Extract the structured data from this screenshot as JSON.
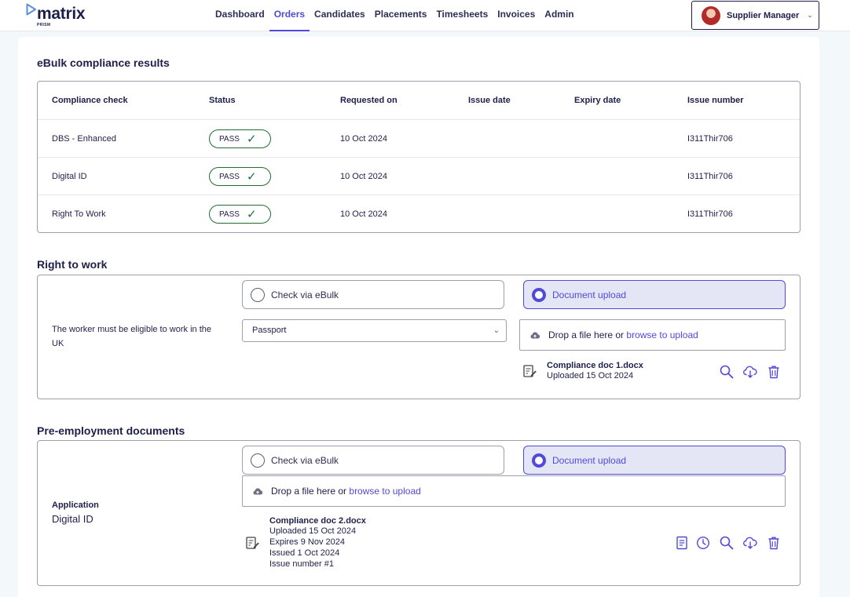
{
  "header": {
    "logo_word": "matrix",
    "logo_sub": "PRISM",
    "nav": [
      {
        "label": "Dashboard",
        "active": false
      },
      {
        "label": "Orders",
        "active": true
      },
      {
        "label": "Candidates",
        "active": false
      },
      {
        "label": "Placements",
        "active": false
      },
      {
        "label": "Timesheets",
        "active": false
      },
      {
        "label": "Invoices",
        "active": false
      },
      {
        "label": "Admin",
        "active": false
      }
    ],
    "user": "Supplier Manager"
  },
  "ebulk": {
    "title": "eBulk compliance results",
    "columns": [
      "Compliance check",
      "Status",
      "Requested on",
      "Issue date",
      "Expiry date",
      "Issue number"
    ],
    "rows": [
      {
        "check": "DBS - Enhanced",
        "status": "PASS",
        "requested": "10 Oct 2024",
        "issue_date": "",
        "expiry_date": "",
        "issue_number": "I311Thir706"
      },
      {
        "check": "Digital ID",
        "status": "PASS",
        "requested": "10 Oct 2024",
        "issue_date": "",
        "expiry_date": "",
        "issue_number": "I311Thir706"
      },
      {
        "check": "Right To Work",
        "status": "PASS",
        "requested": "10 Oct 2024",
        "issue_date": "",
        "expiry_date": "",
        "issue_number": "I311Thir706"
      }
    ]
  },
  "rtw": {
    "title": "Right to work",
    "requirement": "The worker must be eligible to work in the UK",
    "option_ebulk": "Check via eBulk",
    "option_upload": "Document upload",
    "selected": "upload",
    "doc_type": "Passport",
    "drop_text": "Drop a file here or",
    "drop_link": "browse to upload",
    "file": {
      "name": "Compliance doc 1.docx",
      "uploaded": "Uploaded 15 Oct 2024"
    }
  },
  "pre": {
    "title": "Pre-employment documents",
    "req_title": "Application",
    "req_sub": "Digital ID",
    "option_ebulk": "Check via eBulk",
    "option_upload": "Document upload",
    "selected": "upload",
    "drop_text": "Drop a file here or",
    "drop_link": "browse to upload",
    "file": {
      "name": "Compliance doc 2.docx",
      "uploaded": "Uploaded 15 Oct 2024",
      "expires": "Expires 9 Nov 2024",
      "issued": "Issued 1 Oct 2024",
      "issue_number": "Issue number #1"
    }
  },
  "colors": {
    "accent": "#5249d8",
    "pass": "#1f6b34",
    "text": "#1d1f4a"
  }
}
